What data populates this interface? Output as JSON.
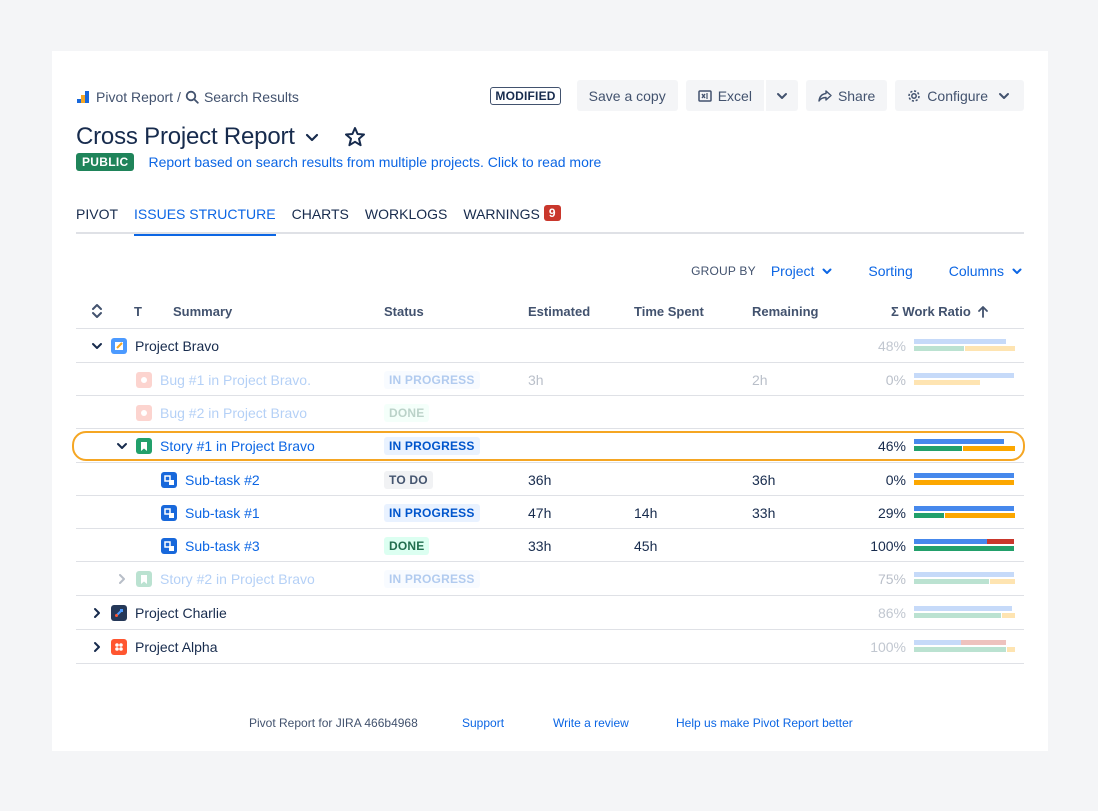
{
  "breadcrumb": {
    "root": "Pivot Report",
    "separator": "/",
    "current": "Search Results"
  },
  "toolbar": {
    "modified": "MODIFIED",
    "save_copy": "Save a copy",
    "excel": "Excel",
    "share": "Share",
    "configure": "Configure"
  },
  "report": {
    "title": "Cross Project Report",
    "visibility": "PUBLIC",
    "description": "Report based on search results from multiple projects. Click to read more"
  },
  "tabs": [
    {
      "label": "PIVOT"
    },
    {
      "label": "ISSUES STRUCTURE",
      "active": true
    },
    {
      "label": "CHARTS"
    },
    {
      "label": "WORKLOGS"
    },
    {
      "label": "WARNINGS",
      "count": "9"
    }
  ],
  "group_by": {
    "label": "GROUP BY",
    "value": "Project",
    "sorting": "Sorting",
    "columns": "Columns"
  },
  "table": {
    "headers": {
      "type": "T",
      "summary": "Summary",
      "status": "Status",
      "estimated": "Estimated",
      "time_spent": "Time Spent",
      "remaining": "Remaining",
      "work_ratio": "Σ Work Ratio"
    },
    "rows": [
      {
        "summary": "Project Bravo",
        "kind": "project",
        "ratio": "48%",
        "bar_top": 0.92,
        "bar_bottom": [
          0.5,
          0.5
        ]
      },
      {
        "summary": "Bug #1 in Project Bravo.",
        "kind": "bug",
        "status": "IN PROGRESS",
        "estimated": "3h",
        "remaining": "2h",
        "ratio": "0%",
        "bar_top": 1.0,
        "bar_bottom": [
          0,
          0.66
        ]
      },
      {
        "summary": "Bug #2 in Project Bravo",
        "kind": "bug",
        "status": "DONE"
      },
      {
        "summary": "Story #1 in Project Bravo",
        "kind": "story",
        "status": "IN PROGRESS",
        "ratio": "46%",
        "bar_top": 0.9,
        "bar_bottom": [
          0.48,
          0.52
        ]
      },
      {
        "summary": "Sub-task #2",
        "kind": "subtask",
        "status": "TO DO",
        "estimated": "36h",
        "remaining": "36h",
        "ratio": "0%",
        "bar_top": 1.0,
        "bar_bottom": [
          0,
          1.0
        ]
      },
      {
        "summary": "Sub-task #1",
        "kind": "subtask",
        "status": "IN PROGRESS",
        "estimated": "47h",
        "time_spent": "14h",
        "remaining": "33h",
        "ratio": "29%",
        "bar_top": 1.0,
        "bar_bottom": [
          0.3,
          0.7
        ]
      },
      {
        "summary": "Sub-task #3",
        "kind": "subtask",
        "status": "DONE",
        "estimated": "33h",
        "time_spent": "45h",
        "ratio": "100%",
        "bar_top": 0.73,
        "bar_top_over": 0.27,
        "bar_bottom": [
          1.0,
          0
        ]
      },
      {
        "summary": "Story #2 in Project Bravo",
        "kind": "story",
        "status": "IN PROGRESS",
        "ratio": "75%",
        "bar_top": 1.0,
        "bar_bottom": [
          0.75,
          0.25
        ]
      },
      {
        "summary": "Project Charlie",
        "kind": "project",
        "ratio": "86%",
        "bar_top": 0.98,
        "bar_bottom": [
          0.87,
          0.13
        ]
      },
      {
        "summary": "Project Alpha",
        "kind": "project",
        "ratio": "100%",
        "bar_top": 0.47,
        "bar_top_over": 0.45,
        "bar_bottom": [
          0.92,
          0.08
        ]
      }
    ]
  },
  "footer": {
    "version": "Pivot Report for JIRA 466b4968",
    "support": "Support",
    "review": "Write a review",
    "feedback": "Help us make Pivot Report better"
  },
  "colors": {
    "blue": "#4688ec",
    "green": "#22a06b",
    "orange": "#fca700",
    "red": "#c9372c",
    "link": "#0c66e4"
  }
}
